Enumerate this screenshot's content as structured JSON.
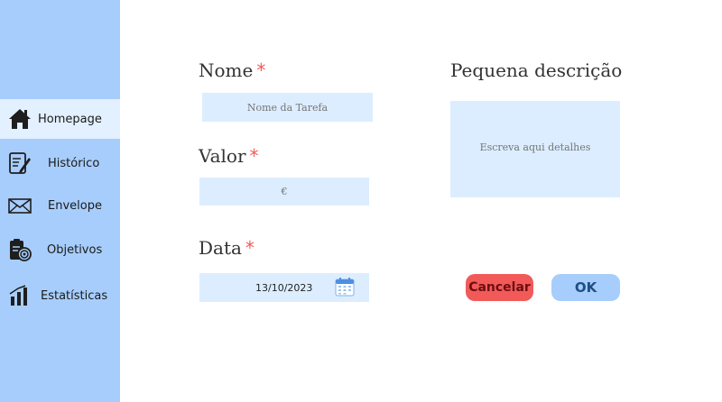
{
  "sidebar": {
    "items": [
      {
        "label": "Homepage",
        "icon": "home-icon"
      },
      {
        "label": "Histórico",
        "icon": "history-icon"
      },
      {
        "label": "Envelope",
        "icon": "envelope-icon"
      },
      {
        "label": "Objetivos",
        "icon": "objectives-icon"
      },
      {
        "label": "Estatísticas",
        "icon": "stats-icon"
      }
    ],
    "active_index": 0
  },
  "form": {
    "name_label": "Nome",
    "name_placeholder": "Nome da Tarefa",
    "value_label": "Valor",
    "value_placeholder": "€",
    "date_label": "Data",
    "date_value": "13/10/2023",
    "required_mark": "*",
    "description_label": "Pequena descrição",
    "description_placeholder": "Escreva aqui detalhes"
  },
  "buttons": {
    "cancel_label": "Cancelar",
    "ok_label": "OK"
  },
  "colors": {
    "sidebar_bg": "#a7cdfc",
    "active_item_bg": "#e3f0ff",
    "field_bg": "#dcedff",
    "required": "#f25a5a",
    "cancel_bg": "#f25a5a",
    "cancel_text": "#6b0f0f",
    "ok_bg": "#a7cdfc",
    "ok_text": "#1f4f86"
  }
}
